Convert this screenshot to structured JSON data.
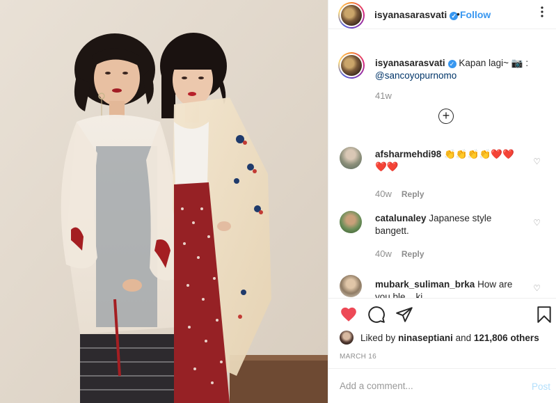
{
  "post": {
    "author": "isyanasarasvati",
    "follow_label": "Follow",
    "separator": "•",
    "more_glyph": "⋮"
  },
  "caption": {
    "username": "isyanasarasvati",
    "text": "Kapan lagi~ 📷 :",
    "mention": "@sancoyopurnomo",
    "time": "41w"
  },
  "load_more_glyph": "+",
  "comments": [
    {
      "username": "afsharmehdi98",
      "text": "👏👏👏👏❤️❤️ ❤️❤️",
      "time": "40w",
      "reply": "Reply"
    },
    {
      "username": "catalunaley",
      "text": "Japanese style bangett.",
      "time": "40w",
      "reply": "Reply"
    },
    {
      "username": "mubark_suliman_brka",
      "text": "How are you ble ...ki"
    }
  ],
  "likes": {
    "prefix": "Liked by",
    "user": "ninaseptiani",
    "and": "and",
    "count": "121,806 others"
  },
  "date": "MARCH 16",
  "comment_input": {
    "placeholder": "Add a comment...",
    "post_label": "Post"
  },
  "colors": {
    "accent": "#3897f0",
    "like_red": "#ed4956",
    "muted": "#8e8e8e"
  },
  "icons": [
    "verified-icon",
    "more-icon",
    "add-circle-icon",
    "heart-icon",
    "comment-icon",
    "share-icon",
    "bookmark-icon"
  ]
}
